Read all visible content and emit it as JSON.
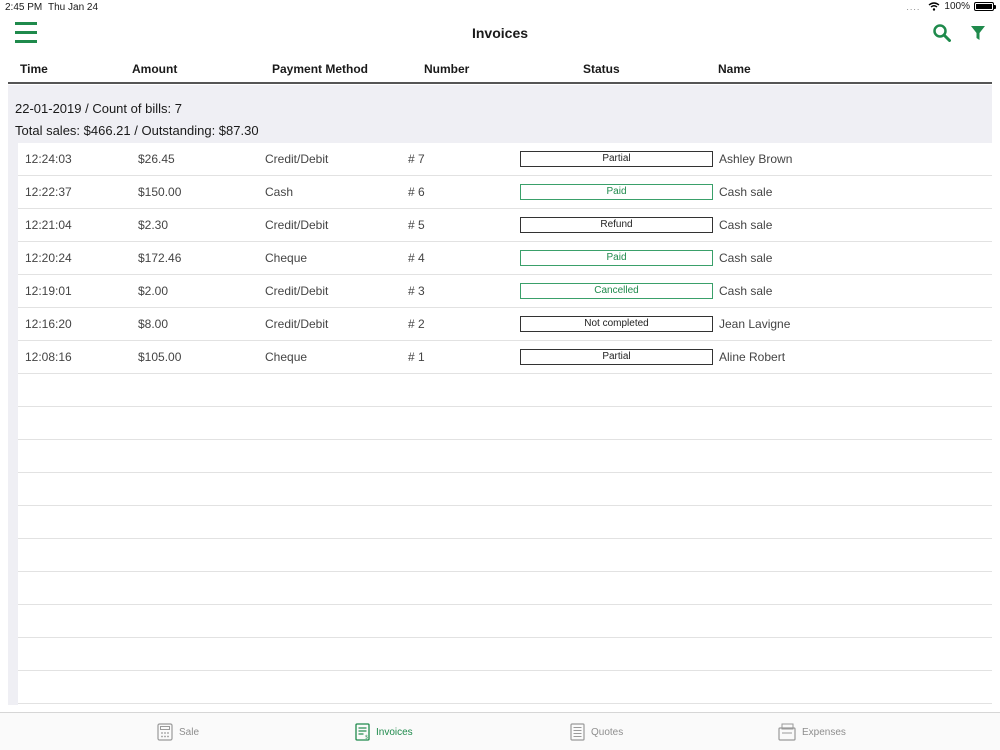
{
  "status_bar": {
    "time": "2:45 PM",
    "date": "Thu Jan 24",
    "dots": "....",
    "battery": "100%"
  },
  "nav": {
    "title": "Invoices",
    "menu_icon": "hamburger-icon",
    "search_icon": "search-icon",
    "filter_icon": "filter-icon"
  },
  "columns": {
    "time": "Time",
    "amount": "Amount",
    "payment": "Payment Method",
    "number": "Number",
    "status": "Status",
    "name": "Name"
  },
  "summary": {
    "line1": "22-01-2019 / Count of bills: 7",
    "line2": "Total sales: $466.21 / Outstanding: $87.30"
  },
  "rows": [
    {
      "time": "12:24:03",
      "amount": "$26.45",
      "payment": "Credit/Debit",
      "number": "# 7",
      "status": "Partial",
      "name": "Ashley Brown"
    },
    {
      "time": "12:22:37",
      "amount": "$150.00",
      "payment": "Cash",
      "number": "# 6",
      "status": "Paid",
      "name": "Cash sale"
    },
    {
      "time": "12:21:04",
      "amount": "$2.30",
      "payment": "Credit/Debit",
      "number": "# 5",
      "status": "Refund",
      "name": "Cash sale"
    },
    {
      "time": "12:20:24",
      "amount": "$172.46",
      "payment": "Cheque",
      "number": "# 4",
      "status": "Paid",
      "name": "Cash sale"
    },
    {
      "time": "12:19:01",
      "amount": "$2.00",
      "payment": "Credit/Debit",
      "number": "# 3",
      "status": "Cancelled",
      "name": "Cash sale"
    },
    {
      "time": "12:16:20",
      "amount": "$8.00",
      "payment": "Credit/Debit",
      "number": "# 2",
      "status": "Not completed",
      "name": "Jean Lavigne"
    },
    {
      "time": "12:08:16",
      "amount": "$105.00",
      "payment": "Cheque",
      "number": "# 1",
      "status": "Partial",
      "name": "Aline Robert"
    }
  ],
  "tabs": [
    {
      "label": "Sale",
      "icon": "calculator-icon",
      "active": false
    },
    {
      "label": "Invoices",
      "icon": "invoice-icon",
      "active": true
    },
    {
      "label": "Quotes",
      "icon": "quote-icon",
      "active": false
    },
    {
      "label": "Expenses",
      "icon": "expenses-icon",
      "active": false
    }
  ],
  "colors": {
    "accent": "#1f8a4c",
    "background": "#efeff4"
  }
}
